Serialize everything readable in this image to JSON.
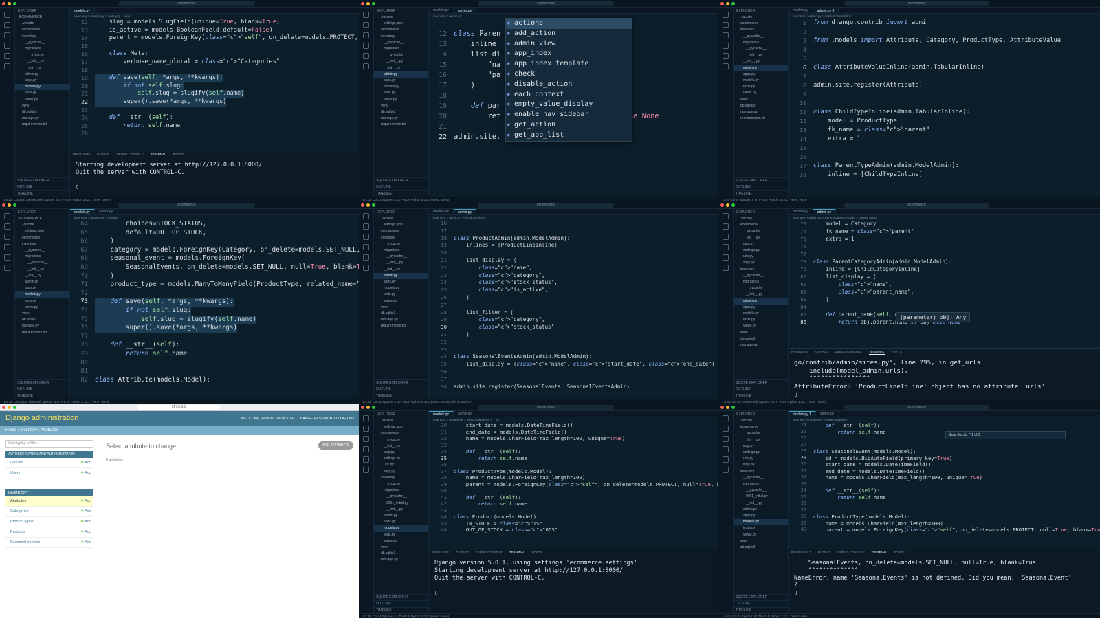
{
  "app": {
    "search": "ecommerce"
  },
  "p1": {
    "tabs": [
      "models.py"
    ],
    "crumb": "inventory > models.py > Category > save",
    "sidebar": {
      "header": "EXPLORER",
      "items": [
        "ECOMMERCE",
        ".vscode",
        "ecommerce",
        "inventory",
        "__pycache__",
        "migrations",
        "__pycache__",
        "__init__.py",
        "__init__.py",
        "admin.py",
        "apps.py",
        "models.py",
        "tests.py",
        "views.py",
        "venv",
        "db.sqlite3",
        "manage.py",
        "requirements.txt"
      ],
      "bottom": [
        "SQLITE EXPLORER",
        "OUTLINE",
        "TIMELINE"
      ]
    },
    "lines": [
      "12",
      "13",
      "14",
      "15",
      "16",
      "17",
      "18",
      "19",
      "20",
      "21",
      "22",
      "23",
      "24",
      "25",
      "26"
    ],
    "code": [
      "    slug = models.SlugField(unique=True, blank=True)",
      "    is_active = models.BooleanField(default=False)",
      "    parent = models.ForeignKey(\"self\", on_delete=models.PROTECT, null=True, blank=",
      "",
      "    class Meta:",
      "        verbose_name_plural = \"Categories\"",
      "",
      "    def save(self, *args, **kwargs):",
      "        if not self.slug:",
      "            self.slug = slugify(self.name)",
      "        super().save(*args, **kwargs)",
      "",
      "    def __str__(self):",
      "        return self.name",
      ""
    ],
    "ptabs": [
      "PROBLEMS",
      "OUTPUT",
      "DEBUG CONSOLE",
      "TERMINAL",
      "PORTS"
    ],
    "terminal": "Starting development server at http://127.0.0.1:8000/\nQuit the server with CONTROL-C.\n\n▯",
    "status": "Ln 22, Col 38 (139 selected)   Spaces: 4   UTF-8   LF   Python   3.12.1 ('venv': venv)"
  },
  "p2": {
    "tabs": [
      "models.py",
      "admin.py"
    ],
    "crumb": "inventory > admin.py",
    "sidebar": {
      "header": "EXPLORER",
      "items": [
        ".vscode",
        "settings.json",
        "ecommerce",
        "inventory",
        "__pycache__",
        "migrations",
        "__pycache__",
        "__init__.py",
        "__init__.py",
        "admin.py",
        "apps.py",
        "models.py",
        "tests.py",
        "views.py",
        "venv",
        "db.sqlite3",
        "manage.py",
        "requirements.txt"
      ],
      "bottom": [
        "SQLITE EXPLORER",
        "OUTLINE",
        "TIMELINE"
      ]
    },
    "lines": [
      "11",
      "12",
      "13",
      "14",
      "15",
      "16",
      "17",
      "18",
      "19",
      "20",
      "21",
      "22"
    ],
    "code": [
      "",
      "class Paren",
      "    inline",
      "    list_di",
      "        \"na",
      "        \"pa",
      "    )",
      "",
      "    def par",
      "        ret",
      "",
      "admin.site."
    ],
    "suffix": {
      "line12": ");",
      "line20": "lse None"
    },
    "autocomplete": [
      "actions",
      "add_action",
      "admin_view",
      "app_index",
      "app_index_template",
      "check",
      "disable_action",
      "each_context",
      "empty_value_display",
      "enable_nav_sidebar",
      "get_action",
      "get_app_list"
    ],
    "status": "Ln 22, Col 12   Spaces: 4   UTF-8   LF   Python   3.12.1 ('venv': venv)"
  },
  "p3": {
    "tabs": [
      "models.py",
      "admin.py 3"
    ],
    "crumb": "inventory > admin.py > AttributeValueInline",
    "sidebar": {
      "header": "EXPLORER",
      "items": [
        ".vscode",
        "ecommerce",
        "inventory",
        "__pycache__",
        "migrations",
        "__pycache__",
        "__init__.py",
        "__init__.py",
        "admin.py",
        "apps.py",
        "models.py",
        "tests.py",
        "views.py",
        "venv",
        "db.sqlite3",
        "manage.py",
        "requirements.txt"
      ],
      "bottom": [
        "SQLITE EXPLORER",
        "OUTLINE",
        "TIMELINE"
      ]
    },
    "lines": [
      "1",
      "2",
      "3",
      "4",
      "5",
      "6",
      "7",
      "8",
      "9",
      "10",
      "11",
      "12",
      "13",
      "14",
      "15",
      "16",
      "17",
      "18"
    ],
    "code": [
      "from django.contrib import admin",
      "",
      "from .models import Attribute, Category, ProductType, AttributeValue",
      "",
      "",
      "class AttributeValueInline(admin.TabularInline)",
      "",
      "admin.site.register(Attribute)",
      "",
      "",
      "class ChildTypeInline(admin.TabularInline):",
      "    model = ProductType",
      "    fk_name = \"parent\"",
      "    extra = 1",
      "",
      "",
      "class ParentTypeAdmin(admin.ModelAdmin):",
      "    inline = [ChildTypeInline]"
    ],
    "status": "Ln 6, Col 47   Spaces: 4   UTF-8   LF   Python   3.12.1 ('venv': venv)"
  },
  "p4": {
    "tabs": [
      "models.py",
      "admin.py"
    ],
    "crumb": "inventory > models.py > Product",
    "sidebar": {
      "header": "EXPLORER",
      "items": [
        "ECOMMERCE",
        ".vscode",
        "settings.json",
        "ecommerce",
        "inventory",
        "__pycache__",
        "migrations",
        "__pycache__",
        "__init__.py",
        "__init__.py",
        "admin.py",
        "apps.py",
        "models.py",
        "tests.py",
        "views.py",
        "venv",
        "db.sqlite3",
        "manage.py",
        "requirements.txt"
      ],
      "bottom": [
        "SQLITE EXPLORER",
        "OUTLINE",
        "TIMELINE"
      ]
    },
    "lines": [
      "64",
      "65",
      "66",
      "67",
      "68",
      "69",
      "70",
      "71",
      "72",
      "73",
      "74",
      "75",
      "76",
      "77",
      "78",
      "79",
      "80",
      "81",
      "82"
    ],
    "code": [
      "        choices=STOCK_STATUS,",
      "        default=OUT_OF_STOCK,",
      "    )",
      "    category = models.ForeignKey(Category, on_delete=models.SET_NULL, nul",
      "    seasonal_event = models.ForeignKey(",
      "        SeasonalEvents, on_delete=models.SET_NULL, null=True, blank=True",
      "    )",
      "    product_type = models.ManyToManyField(ProductType, related_name=\"produ",
      "",
      "    def save(self, *args, **kwargs):",
      "        if not self.slug:",
      "            self.slug = slugify(self.name)",
      "        super().save(*args, **kwargs)",
      "",
      "    def __str__(self):",
      "        return self.name",
      "",
      "",
      "class Attribute(models.Model):"
    ],
    "status": "Ln 73, Col 1 (143 selected)   Spaces: 4   UTF-8   LF   Python   3.12.1 ('venv': venv)"
  },
  "p5": {
    "tabs": [
      "models.py",
      "admin.py"
    ],
    "crumb": "inventory > admin.py > ProductAdmin",
    "sidebar": {
      "header": "EXPLORER",
      "items": [
        ".vscode",
        "settings.json",
        "ecommerce",
        "inventory",
        "__pycache__",
        "migrations",
        "__pycache__",
        "__init__.py",
        "__init__.py",
        "admin.py",
        "apps.py",
        "models.py",
        "tests.py",
        "views.py",
        "venv",
        "db.sqlite3",
        "manage.py",
        "requirements.txt"
      ],
      "bottom": [
        "SQLITE EXPLORER",
        "OUTLINE",
        "TIMELINE"
      ]
    },
    "lines": [
      "16",
      "17",
      "18",
      "19",
      "20",
      "21",
      "22",
      "23",
      "24",
      "25",
      "26",
      "27",
      "28",
      "29",
      "30",
      "31",
      "32",
      "33",
      "34",
      "35",
      "36",
      "37",
      "38"
    ],
    "code": [
      "",
      "",
      "class ProductAdmin(admin.ModelAdmin):",
      "    inlines = [ProductLineInline]",
      "",
      "    list_display = (",
      "        \"name\",",
      "        \"category\",",
      "        \"stock_status\",",
      "        \"is_active\",",
      "    )",
      "",
      "    list_filter = (",
      "        \"category\",",
      "        \"stock_status\"",
      "    )",
      "",
      "",
      "class SeasonalEventsAdmin(admin.ModelAdmin):",
      "    list_display = (\"name\", \"start_date\", \"end_date\")",
      "",
      "",
      "admin.site.register(SeasonalEvents, SeasonalEventsAdmin)"
    ],
    "status": "Ln 30, Col 22   Spaces: 4   UTF-8   LF   Python   3.12.1 ('venv': venv)   1 file to analyze"
  },
  "p6": {
    "tabs": [
      "models.py",
      "admin.py"
    ],
    "crumb": "inventory > admin.py > ParentCategoryAdmin > parent_name",
    "sidebar": {
      "header": "EXPLORER",
      "items": [
        ".vscode",
        "ecommerce",
        "__pycache__",
        "__init__.py",
        "asgi.py",
        "settings.py",
        "urls.py",
        "wsgi.py",
        "inventory",
        "__pycache__",
        "migrations",
        "__pycache__",
        "__init__.py",
        "admin.py",
        "apps.py",
        "models.py",
        "tests.py",
        "views.py",
        "venv",
        "db.sqlite3",
        "manage.py"
      ],
      "bottom": [
        "SQLITE EXPLORER",
        "OUTLINE",
        "TIMELINE"
      ]
    },
    "lines": [
      "73",
      "74",
      "75",
      "76",
      "77",
      "78",
      "79",
      "80",
      "81",
      "82",
      "83",
      "84",
      "85",
      "86"
    ],
    "code": [
      "    model = Category",
      "    fk_name = \"parent\"",
      "    extra = 1",
      "",
      "",
      "class ParentCategoryAdmin(admin.ModelAdmin):",
      "    inline = [ChildCategoryInline]",
      "    list_display = (",
      "        \"name\",",
      "        \"parent_name\",",
      "    )",
      "",
      "    def parent_name(self, obj):",
      "        return obj.parent.name if obj else None"
    ],
    "hover": "(parameter) obj: Any",
    "ptabs": [
      "PROBLEMS",
      "OUTPUT",
      "DEBUG CONSOLE",
      "TERMINAL",
      "PORTS"
    ],
    "terminal": "go/contrib/admin/sites.py\", line 295, in get_urls\n    include(model_admin.urls),\n    ^^^^^^^^^^^^^^^^\nAttributeError: 'ProductLineInline' object has no attribute 'urls'\n▯",
    "status": "Ln 86, Col 38 (3 selected)   Spaces: 4   UTF-8   LF   Python   3.12.1 ('venv': venv)"
  },
  "p7": {
    "url": "127.0.0.1",
    "title": "Django administration",
    "user": "WELCOME, ADMIN. VIEW SITE / CHANGE PASSWORD / LOG OUT",
    "crumb": "Home › Inventory › Attributes",
    "filter": "Start typing to filter...",
    "sections": [
      {
        "name": "AUTHENTICATION AND AUTHORIZATION",
        "rows": [
          "Groups",
          "Users"
        ]
      },
      {
        "name": "INVENTORY",
        "rows": [
          "Attributes",
          "Categories",
          "Product types",
          "Products",
          "Seasonal eventss"
        ]
      }
    ],
    "add_label": "Add",
    "heading": "Select attribute to change",
    "add_button": "ADD ATTRIBUTE",
    "count": "0 attributes"
  },
  "p8": {
    "tabs": [
      "models.py",
      "admin.py"
    ],
    "crumb": "inventory > models.py > SeasonalEvents > __str__",
    "sidebar": {
      "header": "EXPLORER",
      "items": [
        ".vscode",
        "settings.json",
        "ecommerce",
        "__pycache__",
        "__init__.py",
        "asgi.py",
        "settings.py",
        "urls.py",
        "wsgi.py",
        "inventory",
        "__pycache__",
        "migrations",
        "__pycache__",
        "0001_initial.py",
        "__init__.py",
        "admin.py",
        "apps.py",
        "models.py",
        "tests.py",
        "views.py",
        "venv",
        "db.sqlite3",
        "manage.py"
      ],
      "bottom": [
        "SQLITE EXPLORER",
        "OUTLINE",
        "TIMELINE"
      ]
    },
    "lines": [
      "30",
      "31",
      "32",
      "33",
      "34",
      "35",
      "36",
      "37",
      "38",
      "39",
      "40",
      "41",
      "42",
      "43",
      "44",
      "45",
      "46"
    ],
    "code": [
      "    start_date = models.DateTimeField()",
      "    end_date = models.DateTimeField()",
      "    name = models.CharField(max_length=100, unique=True)",
      "",
      "    def __str__(self):",
      "        return self.name",
      "",
      "class ProductType(models.Model):",
      "    name = models.CharField(max_length=100)",
      "    parent = models.ForeignKey(\"self\", on_delete=models.PROTECT, null=True, blank=True)",
      "",
      "    def __str__(self):",
      "        return self.name",
      "",
      "class Product(models.Model):",
      "    IN_STOCK = \"IS\"",
      "    OUT_OF_STOCK = \"OOS\""
    ],
    "ptabs": [
      "PROBLEMS",
      "OUTPUT",
      "DEBUG CONSOLE",
      "TERMINAL",
      "PORTS"
    ],
    "terminal": "Django version 5.0.1, using settings 'ecommerce.settings'\nStarting development server at http://127.0.0.1:8000/\nQuit the server with CONTROL-C.\n\n▯",
    "status": "Ln 35, Col 24   Spaces: 4   UTF-8   LF   Python   3.12.1 ('venv': venv)"
  },
  "p9": {
    "tabs": [
      "models.py 1",
      "admin.py"
    ],
    "crumb": "inventory > models.py > SeasonalEvent",
    "sidebar": {
      "header": "EXPLORER",
      "items": [
        ".vscode",
        "ecommerce",
        "__pycache__",
        "__init__.py",
        "asgi.py",
        "settings.py",
        "urls.py",
        "wsgi.py",
        "inventory",
        "__pycache__",
        "migrations",
        "__pycache__",
        "0001_initial.py",
        "__init__.py",
        "admin.py",
        "apps.py",
        "models.py",
        "tests.py",
        "views.py",
        "venv",
        "db.sqlite3"
      ],
      "bottom": [
        "SQLITE EXPLORER",
        "OUTLINE",
        "TIMELINE"
      ]
    },
    "lines": [
      "24",
      "25",
      "26",
      "27",
      "28",
      "29",
      "30",
      "31",
      "32",
      "33",
      "34",
      "35",
      "36",
      "37",
      "38",
      "39",
      "40"
    ],
    "code": [
      "    def __str__(self):",
      "        return self.name",
      "",
      "",
      "class SeasonalEvent(models.Model):",
      "    id = models.BigAutoField(primary_key=True)",
      "    start_date = models.DateTimeField()",
      "    end_date = models.DateTimeField()",
      "    name = models.CharField(max_length=100, unique=True)",
      "",
      "    def __str__(self):",
      "        return self.name",
      "",
      "",
      "class ProductType(models.Model):",
      "    name = models.CharField(max_length=100)",
      "    parent = models.ForeignKey(\"self\", on_delete=models.PROTECT, null=True, blank=True)"
    ],
    "find": "Seas    Aa .ab. *   1 of 3",
    "ptabs": [
      "PROBLEMS 1",
      "OUTPUT",
      "DEBUG CONSOLE",
      "TERMINAL",
      "PORTS"
    ],
    "terminal": "    SeasonalEvents, on_delete=models.SET_NULL, null=True, blank=True\n    ^^^^^^^^^^^^^^\nNameError: name 'SeasonalEvents' is not defined. Did you mean: 'SeasonalEvent'\n?\n▯",
    "status": "Ln 29, Col 24   Spaces: 4   UTF-8   LF   Python   3.12.1 ('venv': venv)"
  }
}
